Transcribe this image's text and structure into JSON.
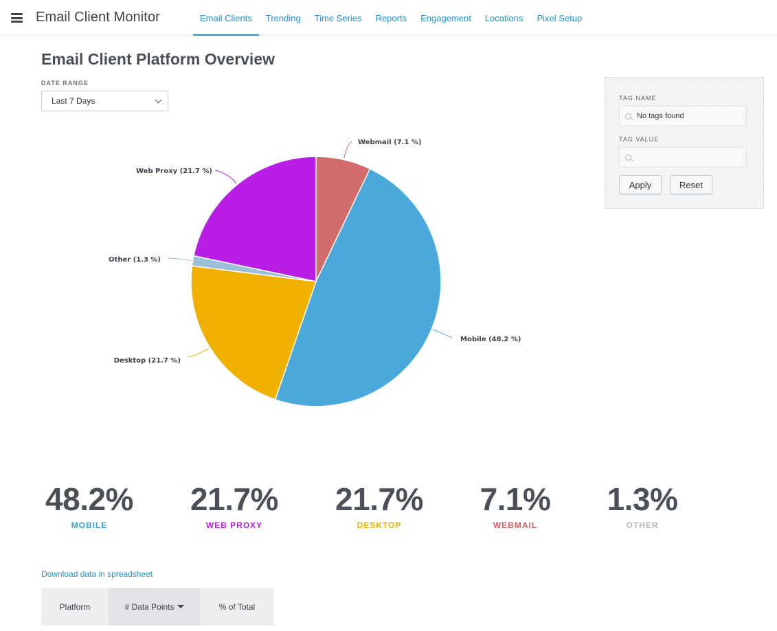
{
  "app": {
    "title": "Email Client Monitor"
  },
  "nav": {
    "items": [
      {
        "label": "Email Clients",
        "active": true
      },
      {
        "label": "Trending"
      },
      {
        "label": "Time Series"
      },
      {
        "label": "Reports"
      },
      {
        "label": "Engagement"
      },
      {
        "label": "Locations"
      },
      {
        "label": "Pixel Setup"
      }
    ]
  },
  "page": {
    "title": "Email Client Platform Overview"
  },
  "date_range": {
    "label": "DATE RANGE",
    "value": "Last 7 Days"
  },
  "tag_panel": {
    "tag_name_label": "TAG NAME",
    "tag_name_value": "No tags found",
    "tag_value_label": "TAG VALUE",
    "tag_value_value": "",
    "apply_label": "Apply",
    "reset_label": "Reset"
  },
  "chart_data": {
    "type": "pie",
    "slices": [
      {
        "name": "Webmail",
        "value": 7.1,
        "label": "Webmail (7.1 %)",
        "color": "#d26c6c"
      },
      {
        "name": "Mobile",
        "value": 48.2,
        "label": "Mobile (48.2 %)",
        "color": "#4aa9da"
      },
      {
        "name": "Desktop",
        "value": 21.7,
        "label": "Desktop (21.7 %)",
        "color": "#f0b000"
      },
      {
        "name": "Other",
        "value": 1.3,
        "label": "Other (1.3 %)",
        "color": "#9bbfd9"
      },
      {
        "name": "Web Proxy",
        "value": 21.7,
        "label": "Web Proxy (21.7 %)",
        "color": "#b81ee6"
      }
    ]
  },
  "stats": [
    {
      "value": "48.2%",
      "name": "MOBILE",
      "color": "#3a9fd6"
    },
    {
      "value": "21.7%",
      "name": "WEB PROXY",
      "color": "#b81ee6"
    },
    {
      "value": "21.7%",
      "name": "DESKTOP",
      "color": "#f0b000"
    },
    {
      "value": "7.1%",
      "name": "WEBMAIL",
      "color": "#d15f5f"
    },
    {
      "value": "1.3%",
      "name": "OTHER",
      "color": "#b3b7bb"
    }
  ],
  "download": {
    "label": "Download data in spreadsheet"
  },
  "table": {
    "headers": [
      {
        "label": "Platform"
      },
      {
        "label": "# Data Points",
        "sorted": true
      },
      {
        "label": "% of Total"
      }
    ]
  },
  "icons": {
    "menu": "hamburger-icon",
    "dropdown": "chevron-down-icon",
    "search": "search-icon",
    "sort": "caret-down-icon"
  }
}
